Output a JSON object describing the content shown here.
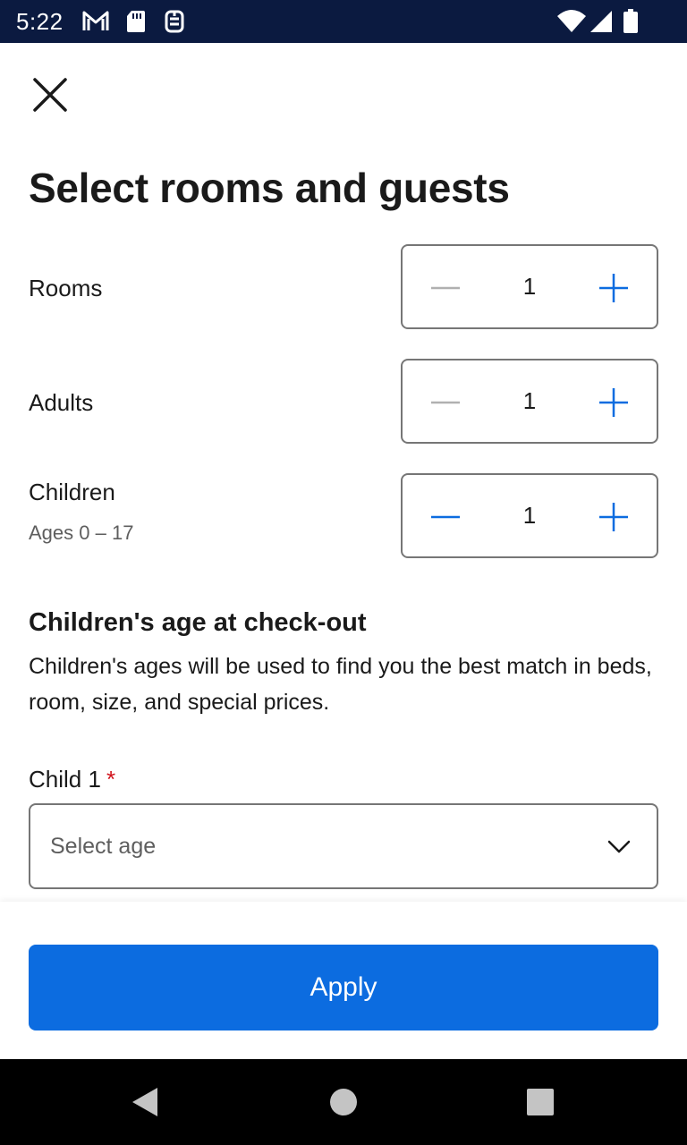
{
  "status_bar": {
    "time": "5:22",
    "left_icons": [
      "gmail-icon",
      "sd-card-icon",
      "sync-icon"
    ],
    "right_icons": [
      "wifi-icon",
      "cell-signal-icon",
      "battery-icon"
    ]
  },
  "title": "Select rooms and guests",
  "steppers": {
    "rooms": {
      "label": "Rooms",
      "value": "1",
      "decrement_enabled": false,
      "increment_enabled": true
    },
    "adults": {
      "label": "Adults",
      "value": "1",
      "decrement_enabled": false,
      "increment_enabled": true
    },
    "children": {
      "label": "Children",
      "sublabel": "Ages 0 – 17",
      "value": "1",
      "decrement_enabled": true,
      "increment_enabled": true
    }
  },
  "children_age": {
    "heading": "Children's age at check-out",
    "description": "Children's ages will be used to find you the best match in beds, room, size, and special prices.",
    "child_label": "Child 1",
    "required_mark": "*",
    "select_placeholder": "Select age"
  },
  "apply_label": "Apply",
  "colors": {
    "accent": "#0c6ce0",
    "status_bar": "#0b1a40",
    "disabled_icon": "#b0b0b0",
    "required": "#d1131c"
  },
  "nav": {
    "icons": [
      "back-icon",
      "home-icon",
      "recents-icon"
    ]
  }
}
